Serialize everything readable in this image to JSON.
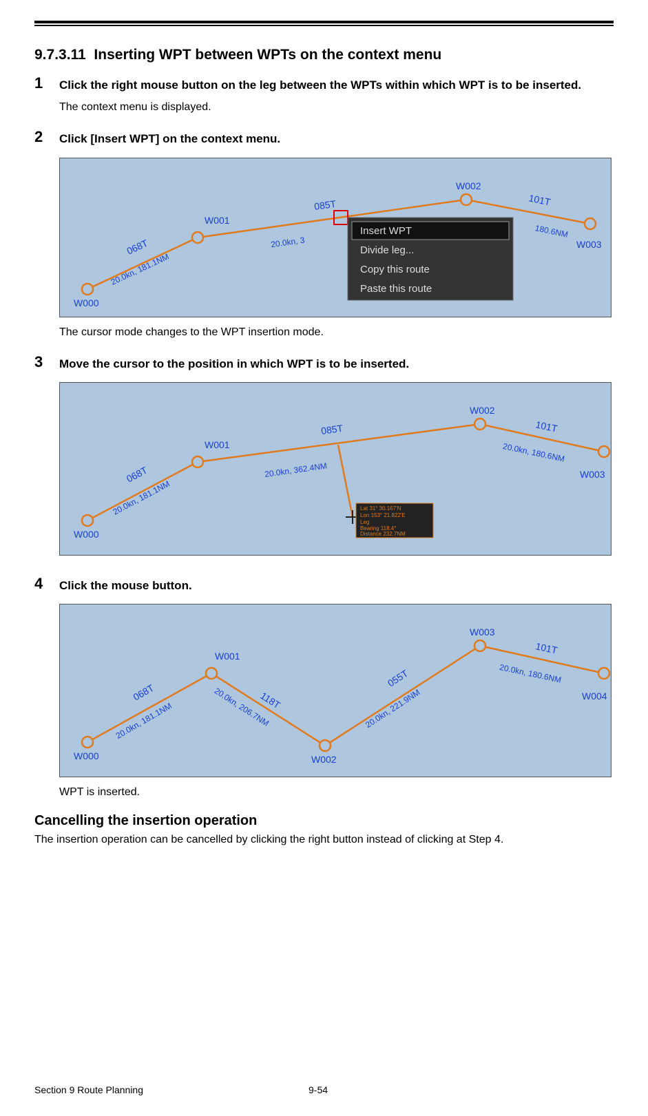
{
  "heading": {
    "number": "9.7.3.11",
    "title": "Inserting WPT between WPTs on the context menu"
  },
  "steps": [
    {
      "num": "1",
      "main": "Click the right mouse button on the leg between the WPTs within which WPT is to be inserted.",
      "note": "The context menu is displayed."
    },
    {
      "num": "2",
      "main": "Click [Insert WPT] on the context menu.",
      "note_after": "The cursor mode changes to the WPT insertion mode."
    },
    {
      "num": "3",
      "main": "Move the cursor to the position in which WPT is to be inserted."
    },
    {
      "num": "4",
      "main": "Click the mouse button.",
      "note_after": "WPT is inserted."
    }
  ],
  "figures": {
    "fig1": {
      "wpts": {
        "w000": "W000",
        "w001": "W001",
        "w002": "W002",
        "w003": "W003"
      },
      "legs": {
        "l0": {
          "hdg": "068T",
          "spd": "20.0kn, 181.1NM"
        },
        "l1": {
          "hdg": "085T",
          "spd": "20.0kn, 3"
        },
        "l2": {
          "hdg": "101T",
          "spd": "180.6NM"
        }
      },
      "menu": {
        "insert": "Insert WPT",
        "divide": "Divide leg...",
        "copy": "Copy this route",
        "paste": "Paste this route"
      }
    },
    "fig2": {
      "wpts": {
        "w000": "W000",
        "w001": "W001",
        "w002": "W002",
        "w003": "W003"
      },
      "legs": {
        "l0": {
          "hdg": "068T",
          "spd": "20.0kn, 181.1NM"
        },
        "l1": {
          "hdg": "085T",
          "spd": "20.0kn, 362.4NM"
        },
        "l2": {
          "hdg": "101T",
          "spd": "20.0kn, 180.6NM"
        }
      },
      "info": {
        "lat": "Lat  31°  30.167'N",
        "lon": "Lon 153°  21.822'E",
        "leg": "Leg",
        "brg": "Bearing 118.4°",
        "dst": "Distance 232.7NM"
      }
    },
    "fig3": {
      "wpts": {
        "w000": "W000",
        "w001": "W001",
        "w002": "W002",
        "w003": "W003",
        "w004": "W004"
      },
      "legs": {
        "l0": {
          "hdg": "068T",
          "spd": "20.0kn, 181.1NM"
        },
        "l1": {
          "hdg": "118T",
          "spd": "20.0kn, 206.7NM"
        },
        "l2": {
          "hdg": "055T",
          "spd": "20.0kn, 221.9NM"
        },
        "l3": {
          "hdg": "101T",
          "spd": "20.0kn, 180.6NM"
        }
      }
    }
  },
  "cancel": {
    "heading": "Cancelling the insertion operation",
    "body": "The insertion operation can be cancelled by clicking the right button instead of clicking at Step 4."
  },
  "footer": {
    "section": "Section 9    Route Planning",
    "page": "9-54"
  }
}
